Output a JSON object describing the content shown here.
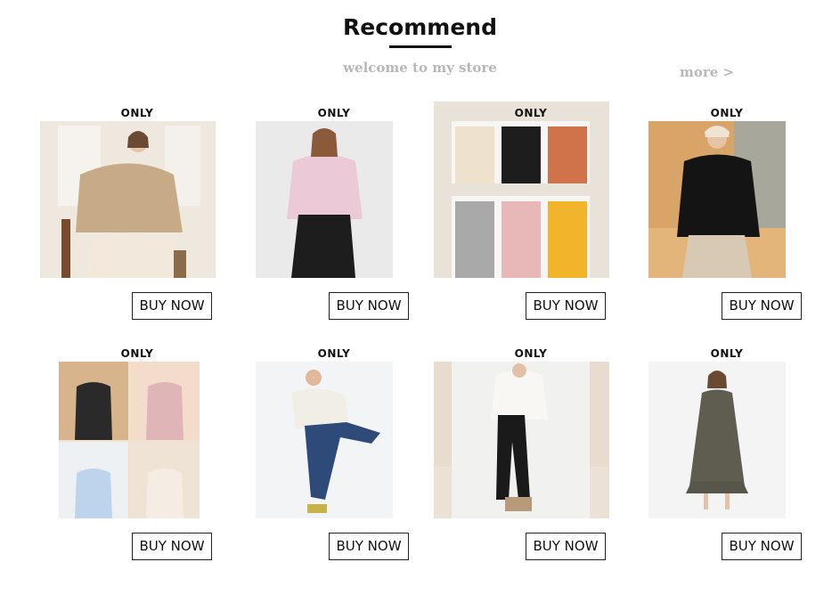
{
  "header": {
    "title": "Recommend",
    "subtitle": "welcome to my store",
    "more_label": "more >"
  },
  "products": [
    {
      "brand": "ONLY",
      "buy_label": "BUY NOW"
    },
    {
      "brand": "ONLY",
      "buy_label": "BUY NOW"
    },
    {
      "brand": "ONLY",
      "buy_label": "BUY NOW"
    },
    {
      "brand": "ONLY",
      "buy_label": "BUY NOW"
    },
    {
      "brand": "ONLY",
      "buy_label": "BUY NOW"
    },
    {
      "brand": "ONLY",
      "buy_label": "BUY NOW"
    },
    {
      "brand": "ONLY",
      "buy_label": "BUY NOW"
    },
    {
      "brand": "ONLY",
      "buy_label": "BUY NOW"
    }
  ],
  "colors": {
    "muted_text": "#b8b8b8",
    "title_text": "#111111",
    "button_border": "#222222"
  }
}
